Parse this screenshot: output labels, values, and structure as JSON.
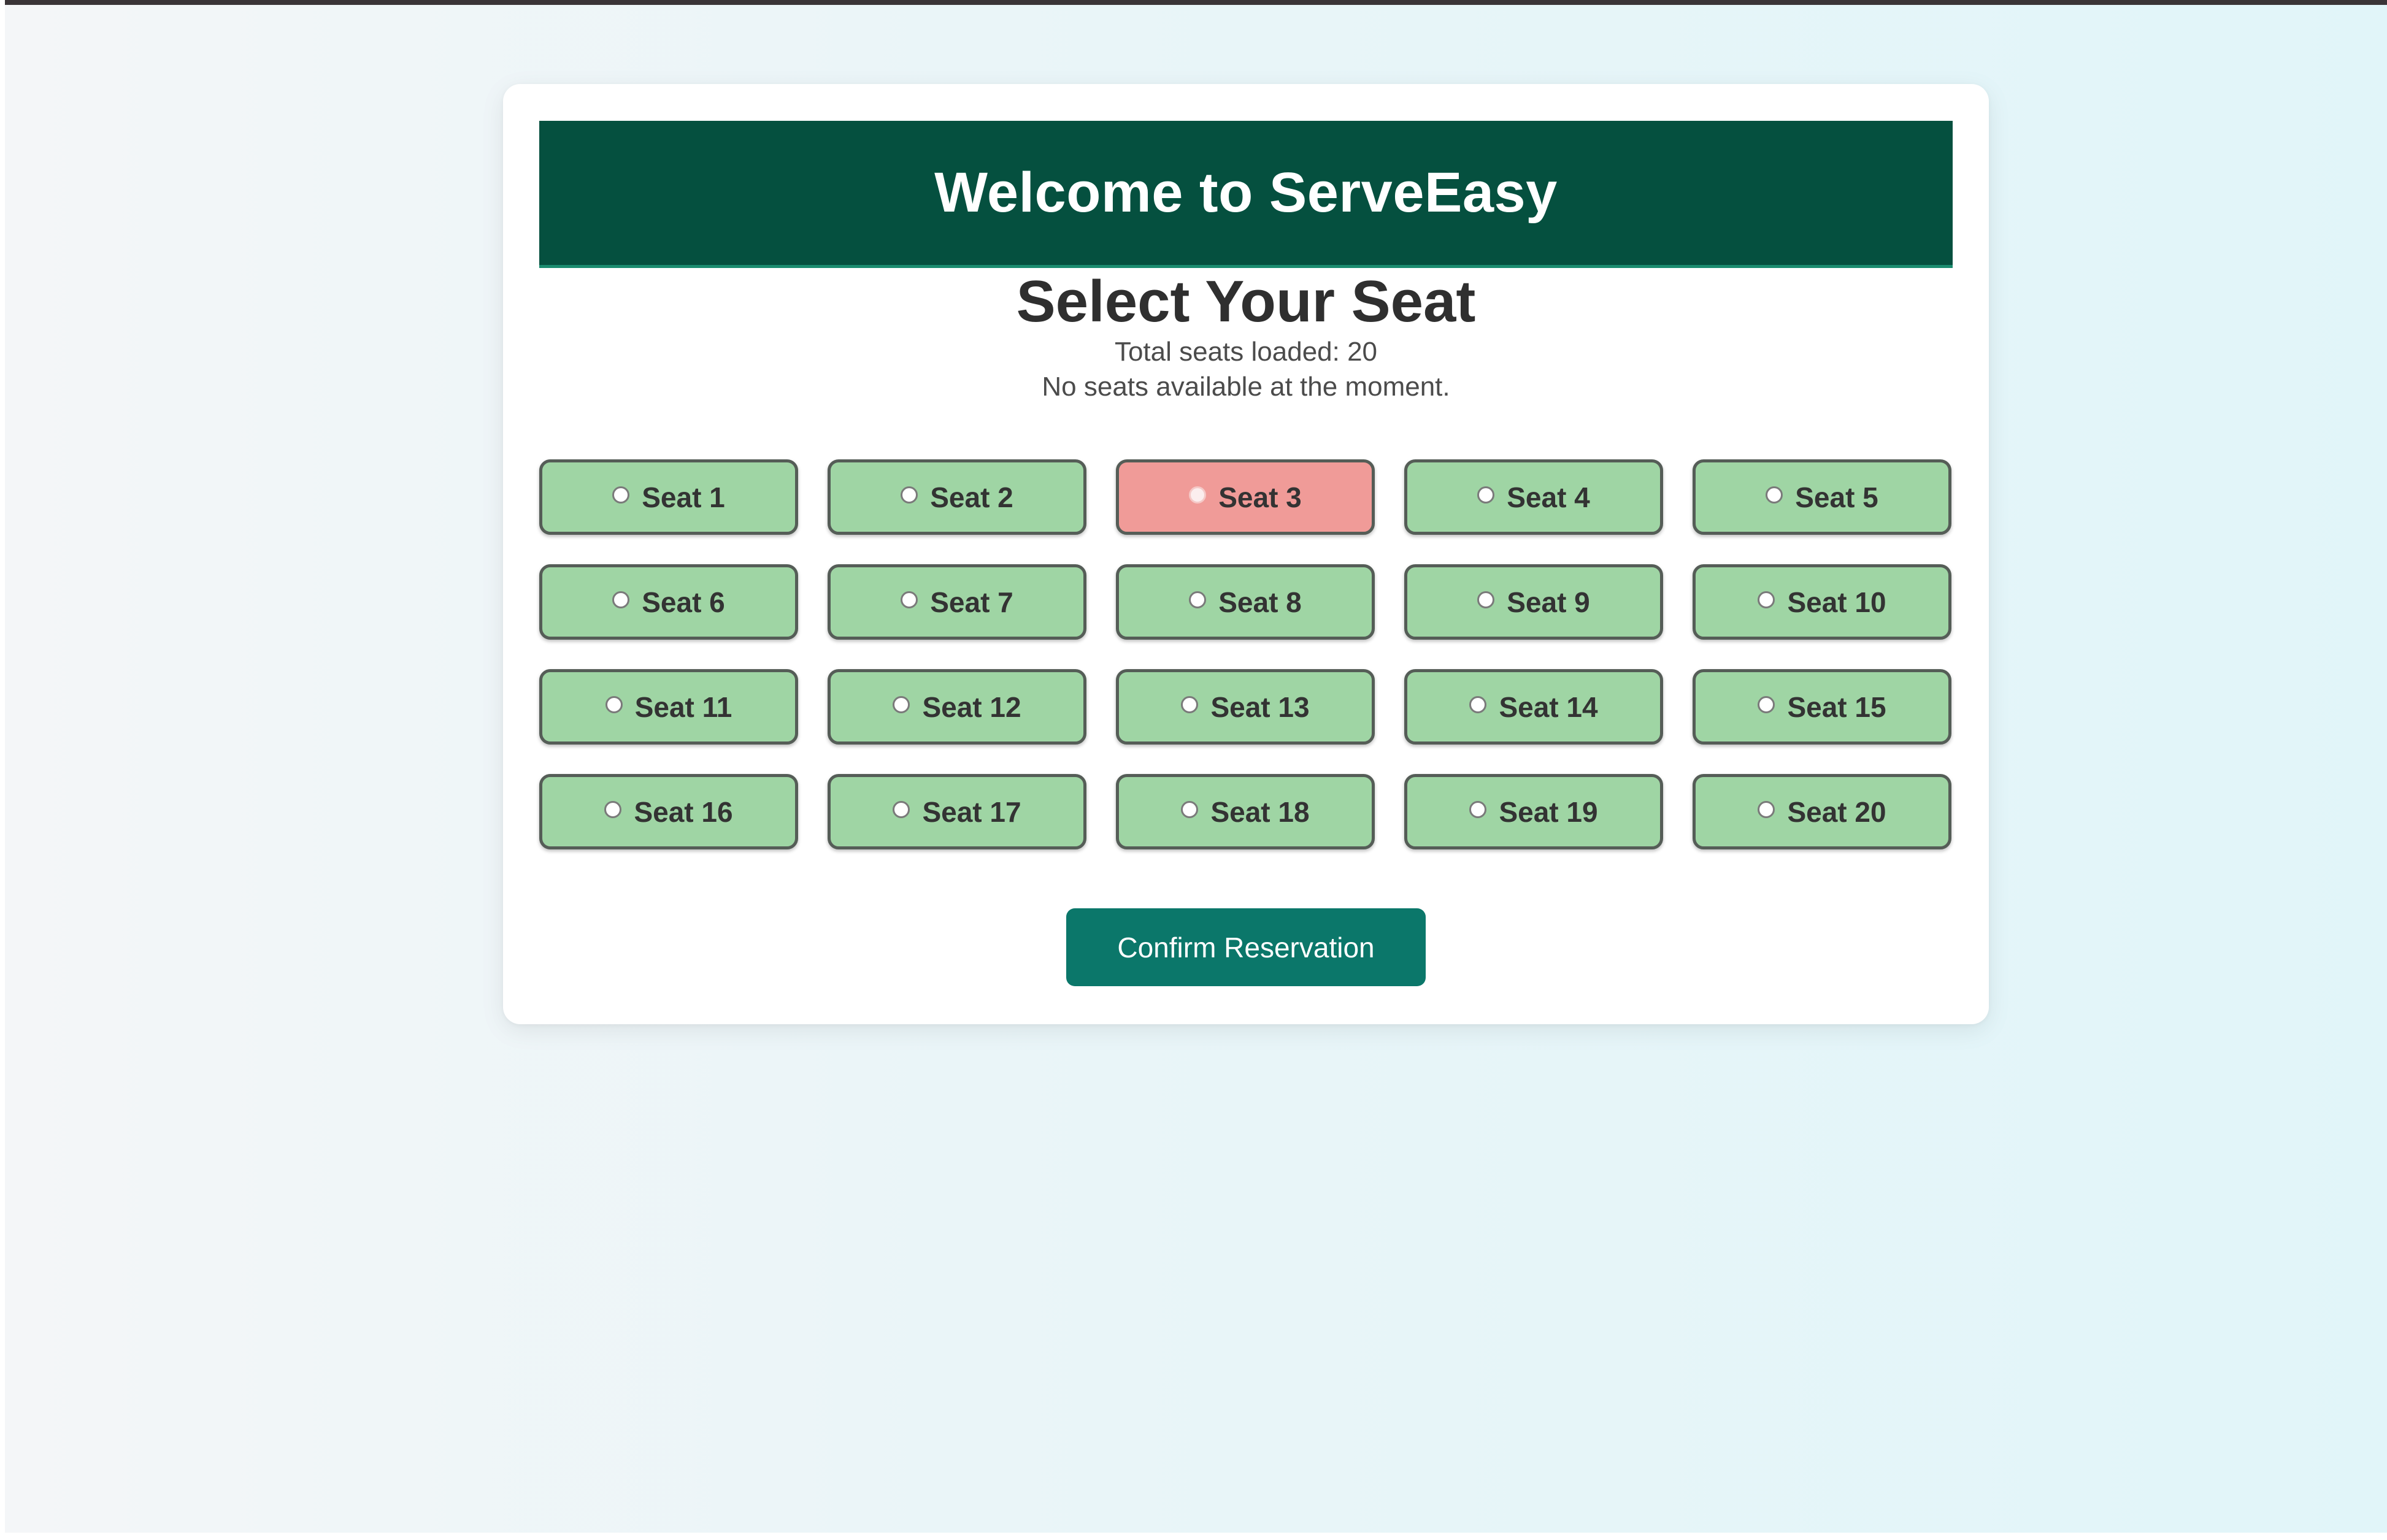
{
  "header": {
    "title": "Welcome to ServeEasy"
  },
  "main": {
    "title": "Select Your Seat",
    "total_seats_text": "Total seats loaded: 20",
    "availability_text": "No seats available at the moment."
  },
  "seats": [
    {
      "label": "Seat 1",
      "selected": false
    },
    {
      "label": "Seat 2",
      "selected": false
    },
    {
      "label": "Seat 3",
      "selected": true
    },
    {
      "label": "Seat 4",
      "selected": false
    },
    {
      "label": "Seat 5",
      "selected": false
    },
    {
      "label": "Seat 6",
      "selected": false
    },
    {
      "label": "Seat 7",
      "selected": false
    },
    {
      "label": "Seat 8",
      "selected": false
    },
    {
      "label": "Seat 9",
      "selected": false
    },
    {
      "label": "Seat 10",
      "selected": false
    },
    {
      "label": "Seat 11",
      "selected": false
    },
    {
      "label": "Seat 12",
      "selected": false
    },
    {
      "label": "Seat 13",
      "selected": false
    },
    {
      "label": "Seat 14",
      "selected": false
    },
    {
      "label": "Seat 15",
      "selected": false
    },
    {
      "label": "Seat 16",
      "selected": false
    },
    {
      "label": "Seat 17",
      "selected": false
    },
    {
      "label": "Seat 18",
      "selected": false
    },
    {
      "label": "Seat 19",
      "selected": false
    },
    {
      "label": "Seat 20",
      "selected": false
    }
  ],
  "confirm_button": {
    "label": "Confirm Reservation"
  },
  "colors": {
    "header_bg": "#05503f",
    "seat_available": "#9fd5a4",
    "seat_selected": "#f09b98",
    "button_bg": "#0b776a"
  }
}
